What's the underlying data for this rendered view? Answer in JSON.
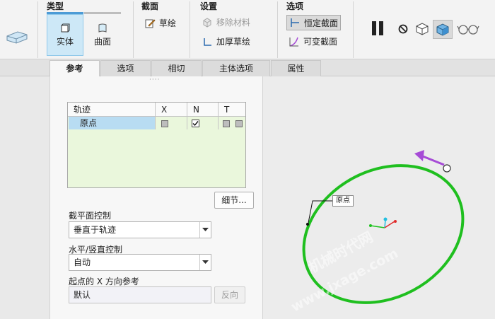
{
  "ribbon": {
    "groups": {
      "type": "类型",
      "section": "截面",
      "settings": "设置",
      "options": "选项"
    },
    "type_buttons": {
      "solid": "实体",
      "surface": "曲面"
    },
    "section_items": {
      "sketch": "草绘"
    },
    "settings_items": {
      "remove_material": "移除材料",
      "thicken_sketch": "加厚草绘"
    },
    "options_items": {
      "constant_section": "恒定截面",
      "variable_section": "可变截面"
    }
  },
  "tabs": [
    "参考",
    "选项",
    "相切",
    "主体选项",
    "属性"
  ],
  "panel": {
    "grip": "····",
    "trajectory_table": {
      "headers": [
        "轨迹",
        "X",
        "N",
        "T"
      ],
      "rows": [
        {
          "name": "原点",
          "N_checked": true
        }
      ]
    },
    "details_button": "细节...",
    "section_plane_control": {
      "label": "截平面控制",
      "value": "垂直于轨迹"
    },
    "hv_control": {
      "label": "水平/竖直控制",
      "value": "自动"
    },
    "start_x_ref": {
      "label": "起点的 X 方向参考",
      "value": "默认",
      "flip_button": "反向"
    }
  },
  "canvas": {
    "annotation": "原点",
    "watermark_line1": "机械时代网",
    "watermark_line2": "www.jxage.com",
    "colors": {
      "trajectory": "#1fbf1f",
      "direction_arrow": "#a64bd6",
      "axis_x": "#e02a2a",
      "axis_y": "#1cc21c",
      "axis_z": "#22bfe0"
    }
  }
}
